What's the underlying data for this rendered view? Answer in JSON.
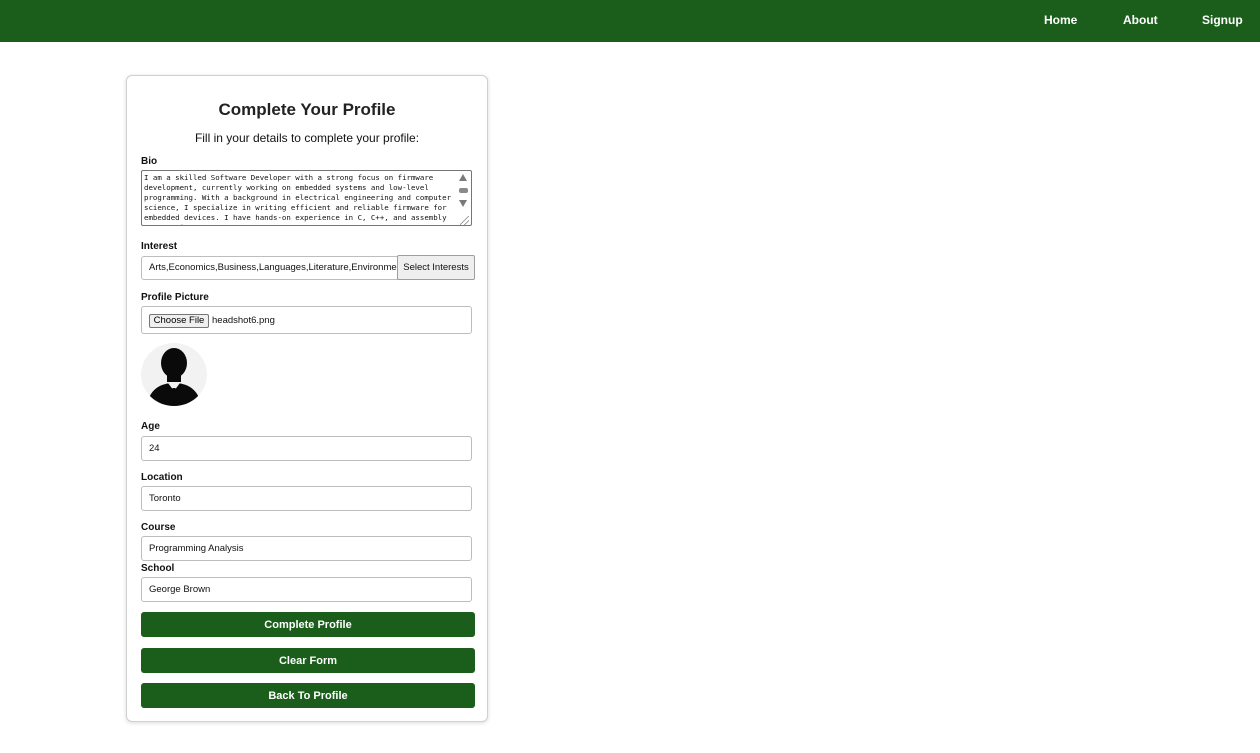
{
  "nav": {
    "home": "Home",
    "about": "About",
    "signup": "Signup"
  },
  "colors": {
    "brand": "#1b5e1b",
    "page_bg": "#ffffff"
  },
  "form": {
    "title": "Complete Your Profile",
    "subtitle": "Fill in your details to complete your profile:",
    "bio": {
      "label": "Bio",
      "value": "I am a skilled Software Developer with a strong focus on firmware development, currently working on embedded systems and low-level programming. With a background in electrical engineering and computer science, I specialize in writing efficient and reliable firmware for embedded devices. I have hands-on experience in C, C++, and assembly programming, as"
    },
    "interest": {
      "label": "Interest",
      "value": "Arts,Economics,Business,Languages,Literature,Environment",
      "button": "Select Interests"
    },
    "picture": {
      "label": "Profile Picture",
      "choose_button": "Choose File",
      "file_name": "headshot6.png",
      "avatar_icon": "person-silhouette-icon"
    },
    "age": {
      "label": "Age",
      "value": "24"
    },
    "location": {
      "label": "Location",
      "value": "Toronto"
    },
    "course": {
      "label": "Course",
      "value": "Programming Analysis"
    },
    "school": {
      "label": "School",
      "value": "George Brown"
    },
    "buttons": {
      "complete": "Complete Profile",
      "clear": "Clear Form",
      "back": "Back To Profile"
    }
  }
}
